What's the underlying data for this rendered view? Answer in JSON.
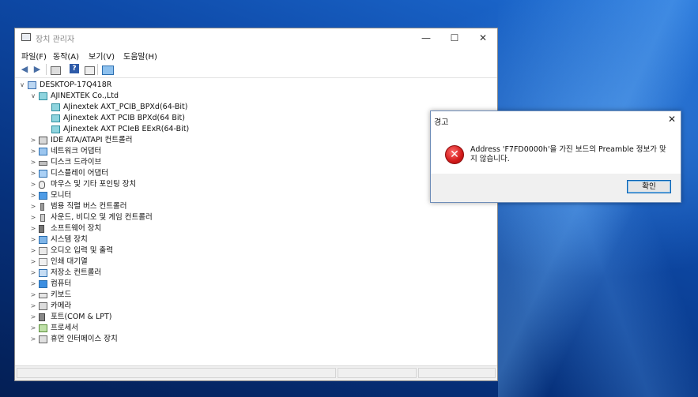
{
  "window": {
    "title": "장치 관리자",
    "controls": {
      "minimize": "—",
      "maximize": "☐",
      "close": "✕"
    },
    "menu": [
      "파일(F)",
      "동작(A)",
      "보기(V)",
      "도움말(H)"
    ]
  },
  "tree": {
    "root": "DESKTOP-17Q418R",
    "vendor": "AJINEXTEK Co.,Ltd",
    "devices": [
      "AJinextek AXT_PCIB_BPXd(64-Bit)",
      "AJinextek AXT PCIB BPXd(64 Bit)",
      "AJinextek AXT PCIeB EExR(64-Bit)"
    ],
    "categories": [
      "IDE ATA/ATAPI 컨트롤러",
      "네트워크 어댑터",
      "디스크 드라이브",
      "디스플레이 어댑터",
      "마우스 및 기타 포인팅 장치",
      "모니터",
      "범용 직렬 버스 컨트롤러",
      "사운드, 비디오 및 게임 컨트롤러",
      "소프트웨어 장치",
      "시스템 장치",
      "오디오 입력 및 출력",
      "인쇄 대기열",
      "저장소 컨트롤러",
      "컴퓨터",
      "키보드",
      "카메라",
      "포트(COM & LPT)",
      "프로세서",
      "휴먼 인터페이스 장치"
    ]
  },
  "dialog": {
    "title": "경고",
    "close": "✕",
    "message": "Address 'F7FD0000h'을 가진 보드의 Preamble 정보가 맞지 않습니다.",
    "ok": "확인"
  }
}
